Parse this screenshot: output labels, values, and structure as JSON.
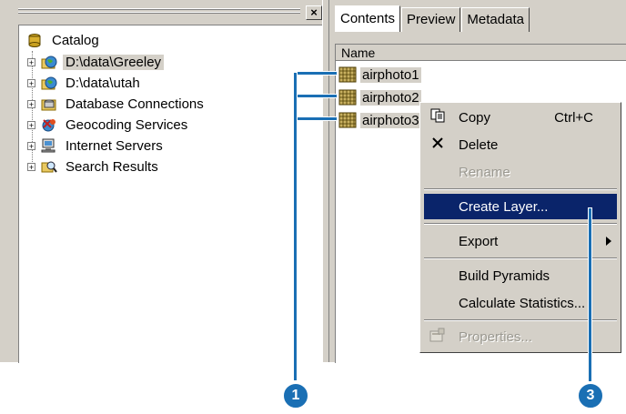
{
  "catalog": {
    "items": [
      {
        "label": "Catalog",
        "icon": "catalog-icon"
      },
      {
        "label": "D:\\data\\Greeley",
        "icon": "folder-globe-icon",
        "selected": true
      },
      {
        "label": "D:\\data\\utah",
        "icon": "folder-globe-icon"
      },
      {
        "label": "Database Connections",
        "icon": "database-icon"
      },
      {
        "label": "Geocoding Services",
        "icon": "geocoding-icon"
      },
      {
        "label": "Internet Servers",
        "icon": "server-icon"
      },
      {
        "label": "Search Results",
        "icon": "search-icon"
      }
    ],
    "close_label": "×"
  },
  "tabs": [
    "Contents",
    "Preview",
    "Metadata"
  ],
  "contents": {
    "column_header": "Name",
    "files": [
      "airphoto1",
      "airphoto2",
      "airphoto3"
    ]
  },
  "context_menu": {
    "items": [
      {
        "label": "Copy",
        "shortcut": "Ctrl+C",
        "icon": "copy-icon"
      },
      {
        "label": "Delete",
        "icon": "delete-icon"
      },
      {
        "label": "Rename",
        "disabled": true
      },
      {
        "label": "Create Layer...",
        "highlighted": true
      },
      {
        "label": "Export",
        "submenu": true
      },
      {
        "label": "Build Pyramids"
      },
      {
        "label": "Calculate Statistics..."
      },
      {
        "label": "Properties...",
        "disabled": true,
        "icon": "properties-icon"
      }
    ]
  },
  "callouts": [
    "1",
    "3"
  ],
  "colors": {
    "callout": "#1a6fb4",
    "highlight": "#0a246a",
    "chrome": "#d4d0c8"
  }
}
